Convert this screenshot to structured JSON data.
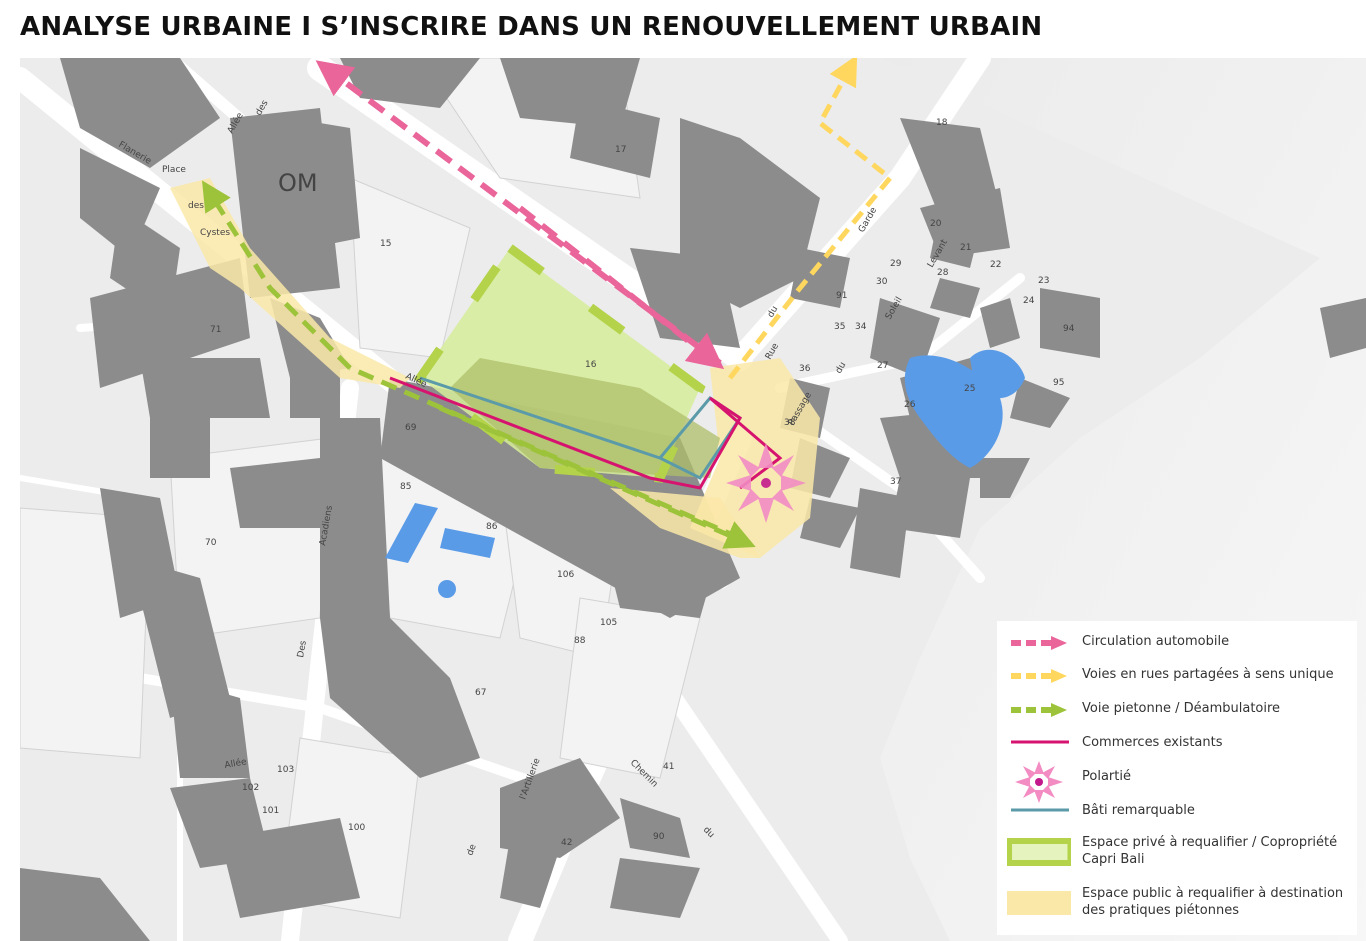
{
  "title": "ANALYSE URBAINE I S’INSCRIRE DANS UN RENOUVELLEMENT URBAIN",
  "map": {
    "district_label": "OM",
    "parcel_numbers": [
      "17",
      "15",
      "16",
      "71",
      "69",
      "70",
      "85",
      "86",
      "106",
      "105",
      "88",
      "67",
      "103",
      "102",
      "101",
      "100",
      "42",
      "41",
      "90",
      "18",
      "20",
      "21",
      "22",
      "23",
      "24",
      "29",
      "30",
      "28",
      "91",
      "35",
      "34",
      "36",
      "27",
      "25",
      "26",
      "38",
      "37",
      "94",
      "95"
    ],
    "street_labels": [
      "Flanerie",
      "Place",
      "des",
      "Cystes",
      "Allée",
      "des",
      "Allée",
      "Acadiens",
      "Des",
      "Allée",
      "Rue",
      "du",
      "Garde",
      "Levant",
      "Soleil",
      "du",
      "Passage",
      "de",
      "l'Artillerie",
      "Chemin",
      "du"
    ]
  },
  "legend": {
    "items": [
      {
        "label": "Circulation automobile",
        "symbol": "pink-dashed-arrow"
      },
      {
        "label": "Voies en rues partagées à sens unique",
        "symbol": "yellow-dashed-arrow"
      },
      {
        "label": "Voie pietonne / Déambulatoire",
        "symbol": "green-dashed-arrow"
      },
      {
        "label": "Commerces existants",
        "symbol": "magenta-line"
      },
      {
        "label": "Polartié",
        "symbol": "pink-star-arrows"
      },
      {
        "label": "Bâti remarquable",
        "symbol": "teal-line"
      },
      {
        "label": "Espace privé à requalifier / Copropriété Capri Bali",
        "symbol": "green-framed-area"
      },
      {
        "label": "Espace public à requalifier à destination des pratiques piétonnes",
        "symbol": "yellow-area"
      }
    ]
  },
  "colors": {
    "building": "#8c8c8c",
    "road": "#ffffff",
    "car_traffic": "#e9659a",
    "shared_street": "#ffd75e",
    "pedestrian": "#9dc33b",
    "shops": "#d6136f",
    "remarkable_building": "#5b9aa8",
    "private_space_fill": "#d6ed9a",
    "public_space_fill": "#fae8a8",
    "water": "#5a9be8"
  }
}
